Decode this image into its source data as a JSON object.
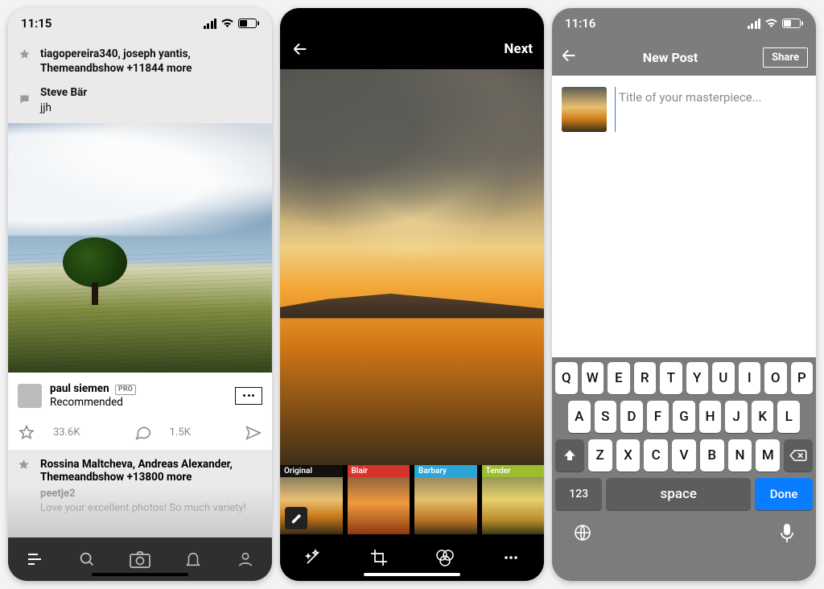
{
  "phone1": {
    "status_time": "11:15",
    "notif_faves": "tiagopereira340, joseph yantis, Themeandbshow +11844 more",
    "notif_comment_user": "Steve Bär",
    "notif_comment_text": "jjh",
    "author_name": "paul siemen",
    "author_badge": "PRO",
    "author_sub": "Recommended",
    "fave_count": "33.6K",
    "comment_count": "1.5K",
    "bottom_faves": "Rossina Maltcheva, Andreas Alexander, Themeandbshow +13800 more",
    "bottom_user": "peetje2",
    "bottom_snippet": "Love your excellent photos! So much variety!"
  },
  "phone2": {
    "next_label": "Next",
    "filters": {
      "original": "Original",
      "blair": "Blair",
      "barbary": "Barbary",
      "tender": "Tender"
    }
  },
  "phone3": {
    "status_time": "11:16",
    "nav_title": "New Post",
    "share_label": "Share",
    "title_placeholder": "Title of your masterpiece...",
    "keys_r1": [
      "Q",
      "W",
      "E",
      "R",
      "T",
      "Y",
      "U",
      "I",
      "O",
      "P"
    ],
    "keys_r2": [
      "A",
      "S",
      "D",
      "F",
      "G",
      "H",
      "J",
      "K",
      "L"
    ],
    "keys_r3": [
      "Z",
      "X",
      "C",
      "V",
      "B",
      "N",
      "M"
    ],
    "key_123": "123",
    "key_space": "space",
    "key_done": "Done"
  }
}
